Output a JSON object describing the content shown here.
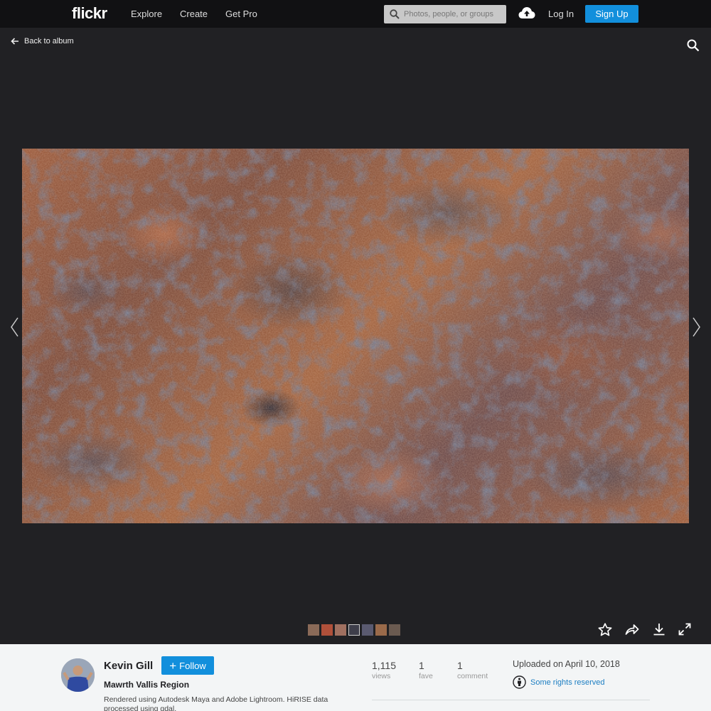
{
  "nav": {
    "logo": "flickr",
    "links": [
      "Explore",
      "Create",
      "Get Pro"
    ],
    "search_placeholder": "Photos, people, or groups",
    "login": "Log In",
    "signup": "Sign Up"
  },
  "viewer": {
    "back_label": "Back to album",
    "icons": [
      "arrow-left-icon",
      "search-icon",
      "chevron-left-icon",
      "chevron-right-icon",
      "star-icon",
      "share-icon",
      "download-icon",
      "fullscreen-icon"
    ],
    "thumbnails": [
      "#8a6a58",
      "#b0503a",
      "#a07060",
      "#3e3e4a",
      "#5a5a70",
      "#9a6a4a",
      "#6a5a50"
    ],
    "active_thumbnail": 3
  },
  "photo_info": {
    "owner": "Kevin Gill",
    "follow_label": "Follow",
    "title": "Mawrth Vallis Region",
    "description": "Rendered using Autodesk Maya and Adobe Lightroom. HiRISE data processed using gdal.",
    "stats": [
      {
        "value": "1,115",
        "label": "views"
      },
      {
        "value": "1",
        "label": "fave"
      },
      {
        "value": "1",
        "label": "comment"
      }
    ],
    "uploaded": "Uploaded on April 10, 2018",
    "license": "Some rights reserved"
  },
  "colors": {
    "accent": "#128fdc",
    "nav_bg": "#111113",
    "viewer_bg": "#212124",
    "info_bg": "#f3f5f6"
  }
}
